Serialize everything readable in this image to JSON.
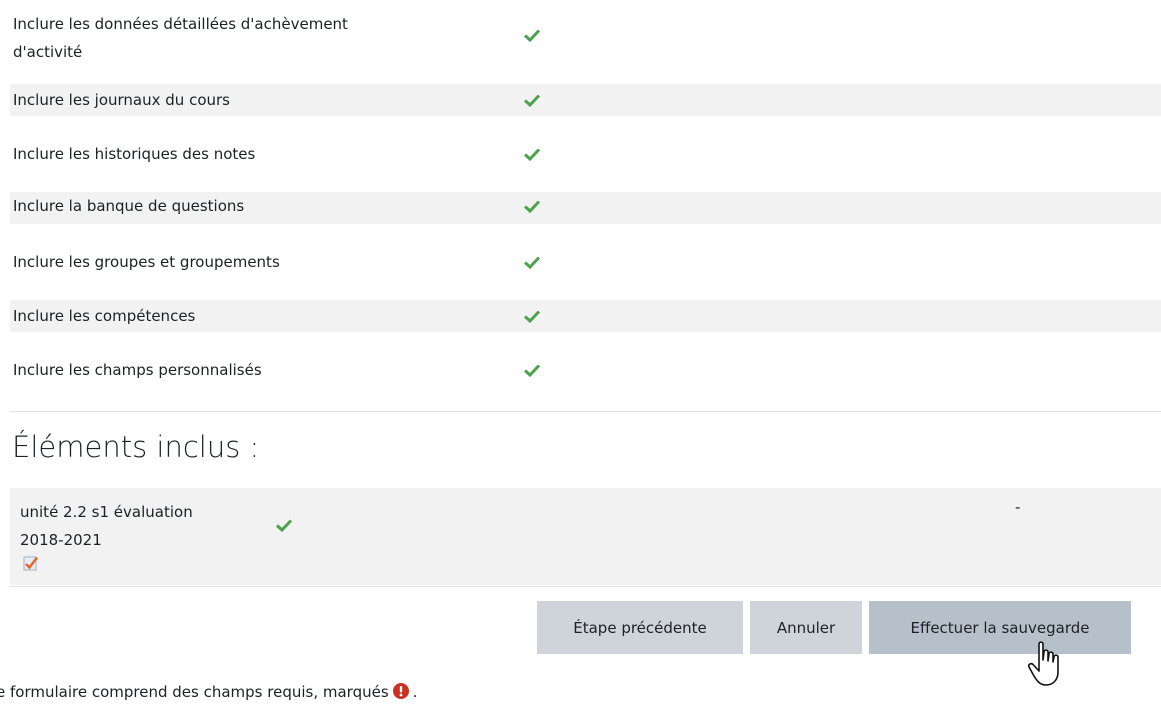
{
  "settings": [
    {
      "label_lines": [
        "Inclure les données détaillées d'achèvement",
        "d'activité"
      ],
      "checked": true
    },
    {
      "label": "Inclure les journaux du cours",
      "checked": true
    },
    {
      "label": "Inclure les historiques des notes",
      "checked": true
    },
    {
      "label": "Inclure la banque de questions",
      "checked": true
    },
    {
      "label": "Inclure les groupes et groupements",
      "checked": true
    },
    {
      "label": "Inclure les compétences",
      "checked": true
    },
    {
      "label": "Inclure les champs personnalisés",
      "checked": true
    }
  ],
  "included": {
    "heading": "Éléments inclus :",
    "item": {
      "name_line1": "unité 2.2 s1 évaluation",
      "name_line2": "2018-2021",
      "checked": true,
      "dash": "-"
    }
  },
  "buttons": {
    "previous": "Étape précédente",
    "cancel": "Annuler",
    "save": "Effectuer la sauvegarde"
  },
  "footer": {
    "text_before": "e formulaire comprend des champs requis, marqués",
    "text_after": "."
  },
  "colors": {
    "check": "#4ea24e",
    "required": "#ca3120",
    "row_shade": "#f2f2f2",
    "button": "#ced4da",
    "button_primary": "#b6c0cb"
  },
  "icons": {
    "check": "check-icon",
    "required": "exclamation-circle-icon",
    "edit": "edit-icon",
    "cursor": "hand-pointer-icon"
  }
}
